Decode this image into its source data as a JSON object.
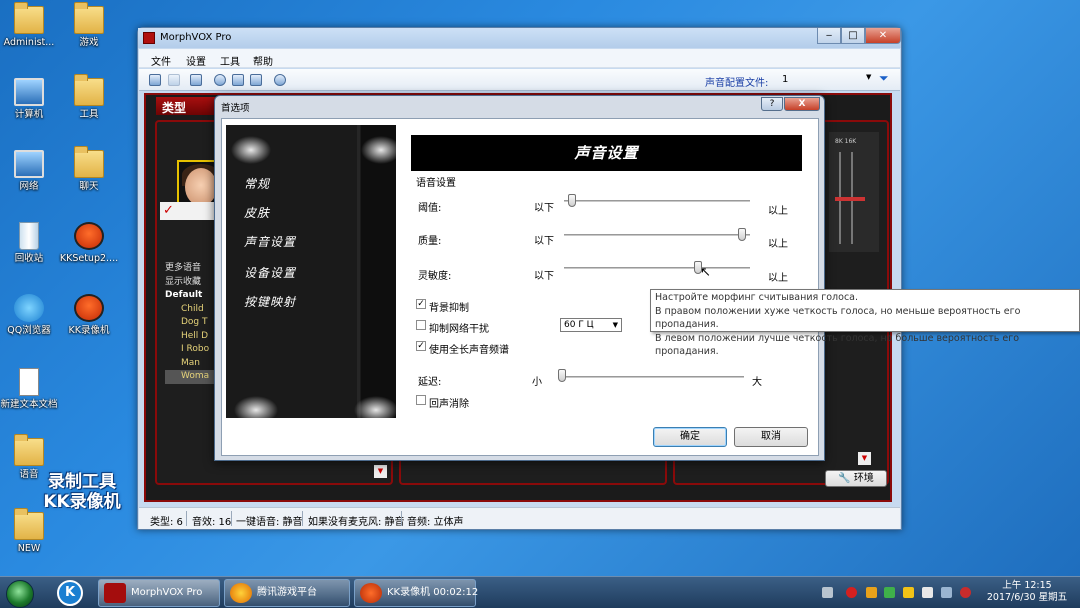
{
  "desktop": {
    "icons": [
      {
        "label": "Administ...",
        "type": "folder"
      },
      {
        "label": "游戏",
        "type": "folder"
      },
      {
        "label": "计算机",
        "type": "pc"
      },
      {
        "label": "工具",
        "type": "folder"
      },
      {
        "label": "网络",
        "type": "pc"
      },
      {
        "label": "聊天",
        "type": "folder"
      },
      {
        "label": "回收站",
        "type": "bin"
      },
      {
        "label": "KKSetup2....",
        "type": "kk"
      },
      {
        "label": "QQ浏览器",
        "type": "qq"
      },
      {
        "label": "KK录像机",
        "type": "kk"
      },
      {
        "label": "新建文本文档",
        "type": "txt"
      },
      {
        "label": "语音",
        "type": "folder"
      },
      {
        "label": "NEW",
        "type": "folder"
      }
    ],
    "watermark_line1": "录制工具",
    "watermark_line2": "KK录像机"
  },
  "main_window": {
    "title": "MorphVOX Pro",
    "menu": [
      "文件",
      "设置",
      "工具",
      "帮助"
    ],
    "profile_label": "声音配置文件:",
    "profile_value": "1",
    "left_header": "类型",
    "voice_list": [
      "更多语音",
      "显示收藏",
      "Default",
      "Child",
      "Dog T",
      "Hell D",
      "I Robo",
      "Man",
      "Woma"
    ],
    "env_button": "环境",
    "status": {
      "type": "类型: 6",
      "sounds": "音效: 16",
      "onekey": "一键语音: 静音",
      "nomic": "如果没有麦克风: 静音",
      "audio": "音频: 立体声"
    }
  },
  "prefs": {
    "title": "首选项",
    "help_btn": "?",
    "close_btn": "X",
    "nav": [
      "常规",
      "皮肤",
      "声音设置",
      "设备设置",
      "按键映射"
    ],
    "banner": "声音设置",
    "group_label": "语音设置",
    "threshold": {
      "label": "阈值:",
      "low": "以下",
      "high": "以上",
      "value": 0.02
    },
    "quality": {
      "label": "质量:",
      "low": "以下",
      "high": "以上",
      "value": 0.98
    },
    "sensitivity": {
      "label": "灵敏度:",
      "low": "以下",
      "high": "以上",
      "value": 0.73
    },
    "bg_suppress": {
      "label": "背景抑制",
      "checked": true
    },
    "hum_suppress": {
      "label": "抑制网络干扰",
      "checked": false,
      "freq": "60 Г Ц"
    },
    "full_spectrum": {
      "label": "使用全长声音频谱",
      "checked": true
    },
    "latency": {
      "label": "延迟:",
      "low": "小",
      "high": "大",
      "value": 0.0
    },
    "echo_cancel": {
      "label": "回声消除",
      "checked": false
    },
    "ok": "确定",
    "cancel": "取消"
  },
  "tooltip": {
    "lines": [
      "Настройте морфинг считывания голоса.",
      "В правом положении хуже четкость голоса, но меньше вероятность его пропадания.",
      "В левом положении лучше четкость голоса, но больше вероятность его пропадания."
    ]
  },
  "taskbar": {
    "items": [
      "MorphVOX Pro",
      "腾讯游戏平台",
      "KK录像机 00:02:12"
    ],
    "time": "上午 12:15",
    "date": "2017/6/30 星期五"
  }
}
